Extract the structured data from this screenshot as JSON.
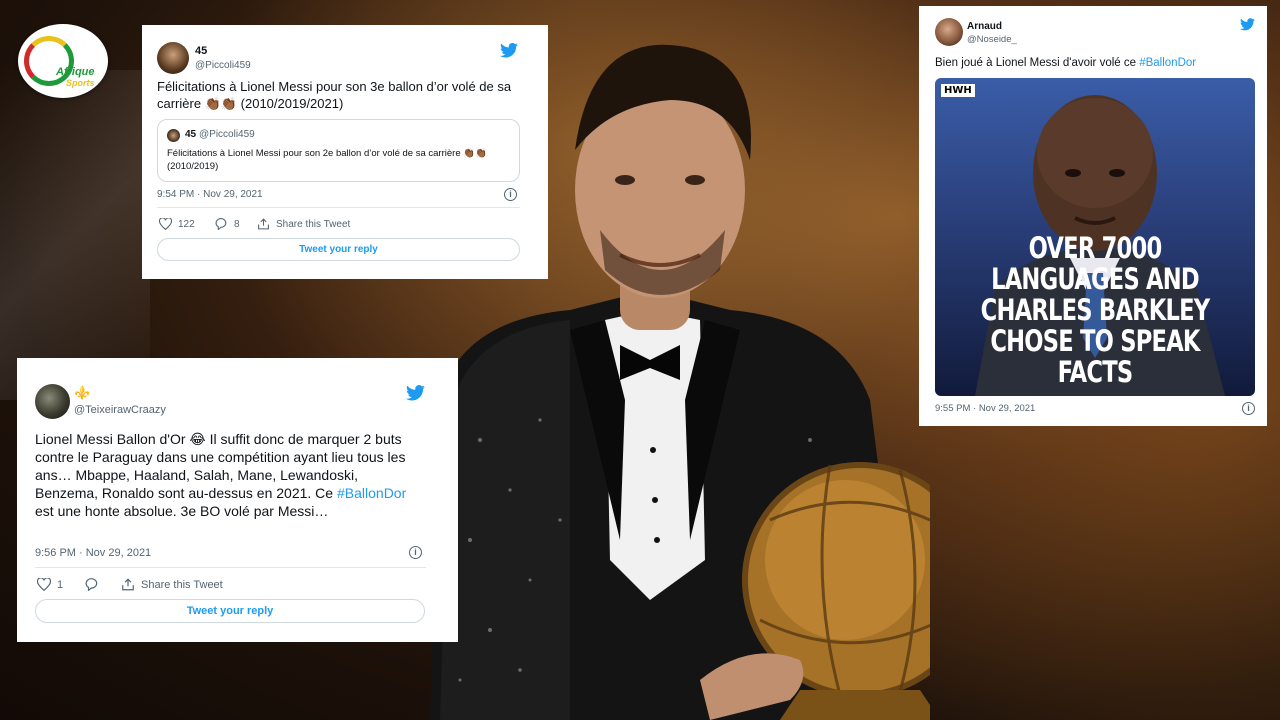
{
  "logo": {
    "line1": "Afrique",
    "line2": "Sports"
  },
  "tweets": {
    "t1": {
      "name": "45",
      "handle": "@Piccoli459",
      "text": "Félicitations à Lionel Messi pour son 3e ballon d’or volé de sa carrière 👏🏾👏🏾 (2010/2019/2021)",
      "quote": {
        "name": "45",
        "handle": "@Piccoli459",
        "text": "Félicitations à Lionel Messi pour son 2e ballon d’or volé de sa carrière 👏🏾👏🏾 (2010/2019)"
      },
      "timestamp": "9:54 PM · Nov 29, 2021",
      "likes": "122",
      "replies": "8",
      "share_label": "Share this Tweet",
      "reply_label": "Tweet your reply"
    },
    "t2": {
      "name": "⚜️",
      "handle": "@TeixeirawCraazy",
      "text_before": "Lionel Messi Ballon d'Or 😂 Il suffit donc de marquer 2 buts contre le Paraguay dans une compétition ayant lieu tous les ans… Mbappe, Haaland, Salah, Mane, Lewandoski, Benzema, Ronaldo sont au-dessus en 2021. Ce ",
      "hashtag": "#BallonDor",
      "text_after": " est une honte absolue. 3e BO volé par Messi…",
      "timestamp": "9:56 PM · Nov 29, 2021",
      "likes": "1",
      "share_label": "Share this Tweet",
      "reply_label": "Tweet your reply"
    },
    "t3": {
      "name": "Arnaud",
      "handle": "@Noseide_",
      "text_before": "Bien joué à Lionel Messi d'avoir volé ce ",
      "hashtag": "#BallonDor",
      "meme_badge": "HWH",
      "meme_text": "OVER 7000 LANGUAGES AND CHARLES BARKLEY CHOSE TO SPEAK FACTS",
      "timestamp": "9:55 PM · Nov 29, 2021"
    }
  },
  "colors": {
    "twitter_blue": "#1d9bf0",
    "text": "#0f1419",
    "muted": "#536471"
  },
  "icons": [
    "twitter-bird-icon",
    "heart-icon",
    "reply-icon",
    "share-icon",
    "info-icon"
  ]
}
